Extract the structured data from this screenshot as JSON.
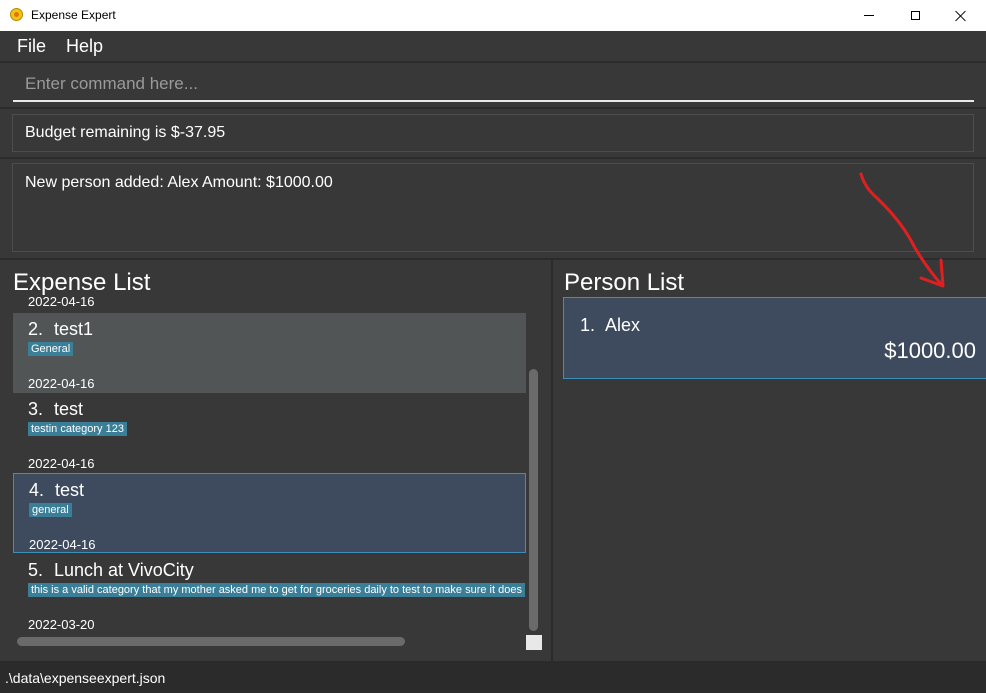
{
  "window": {
    "title": "Expense Expert",
    "icon": "app-coin-icon"
  },
  "menu": {
    "items": [
      {
        "label": "File"
      },
      {
        "label": "Help"
      }
    ]
  },
  "command": {
    "placeholder": "Enter command here..."
  },
  "budget": {
    "text": "Budget remaining is $-37.95"
  },
  "result": {
    "text": "New person added: Alex Amount: $1000.00"
  },
  "expense_list": {
    "title": "Expense List",
    "partial_date": "2022-04-16",
    "items": [
      {
        "index": "2.",
        "title": "test1",
        "tag": "General",
        "date": "2022-04-16"
      },
      {
        "index": "3.",
        "title": "test",
        "tag": "testin category 123",
        "date": "2022-04-16"
      },
      {
        "index": "4.",
        "title": "test",
        "tag": "general",
        "date": "2022-04-16"
      },
      {
        "index": "5.",
        "title": "Lunch at VivoCity",
        "tag": "this is a valid category that my mother asked me to get for groceries daily to test to make sure it does",
        "date": "2022-03-20"
      }
    ]
  },
  "person_list": {
    "title": "Person List",
    "items": [
      {
        "index": "1.",
        "name": "Alex",
        "amount": "$1000.00"
      }
    ]
  },
  "status": {
    "path": ".\\data\\expenseexpert.json"
  },
  "colors": {
    "background": "#383838",
    "selected_card": "#3e4a5e",
    "selected_border": "#3b8fb8",
    "tag": "#3a7e98",
    "annotation": "#e02020"
  }
}
